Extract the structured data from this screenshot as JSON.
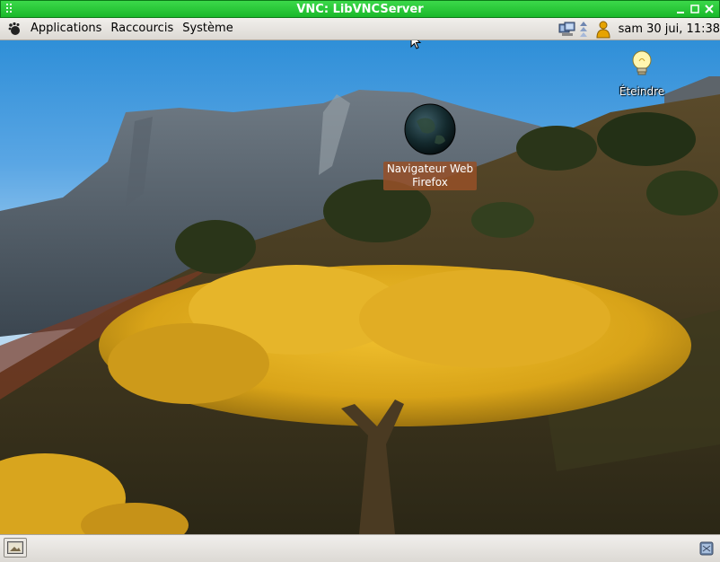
{
  "window": {
    "title": "VNC: LibVNCServer"
  },
  "top_panel": {
    "menus": [
      {
        "label": "Applications"
      },
      {
        "label": "Raccourcis"
      },
      {
        "label": "Système"
      }
    ],
    "clock": "sam 30 jui, 11:38"
  },
  "desktop": {
    "icons": [
      {
        "label_line1": "Navigateur Web",
        "label_line2": "Firefox",
        "icon": "firefox-icon"
      },
      {
        "label": "Éteindre",
        "icon": "lightbulb-icon"
      }
    ]
  },
  "colors": {
    "titlebar": "#22c233",
    "panel": "#e6e3de",
    "firefox_label_bg": "#96502a"
  }
}
